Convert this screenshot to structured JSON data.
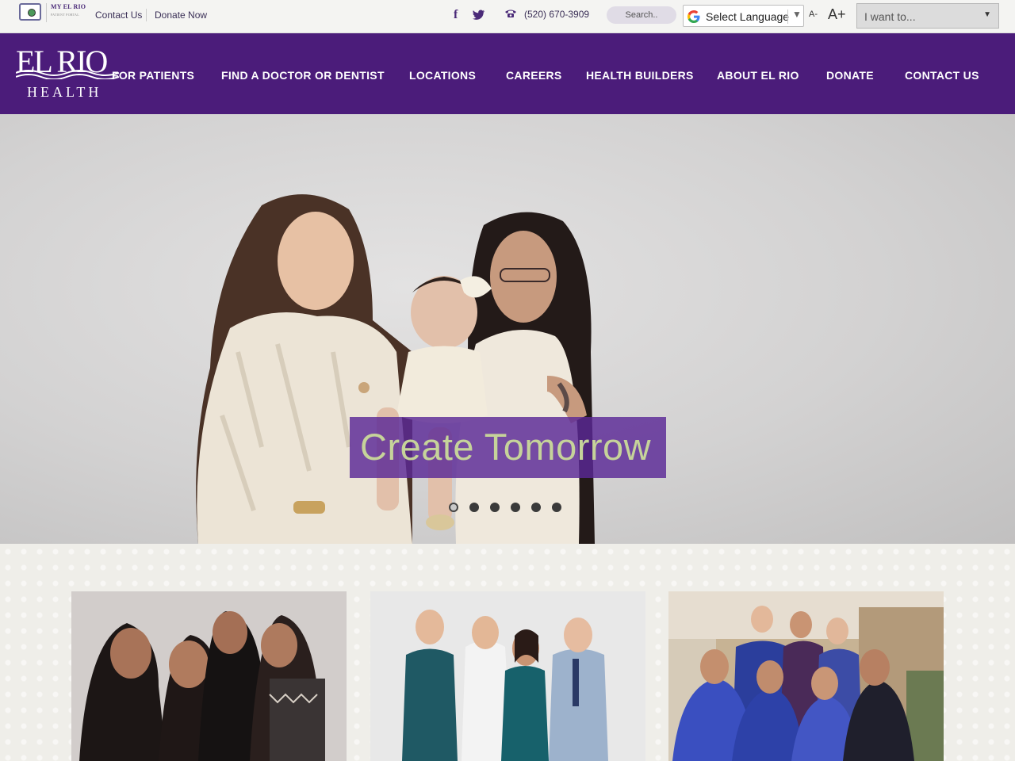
{
  "utility": {
    "portal_logo_line1": "MY EL RIO",
    "portal_logo_line2": "PATIENT PORTAL",
    "contact_label": "Contact Us",
    "donate_label": "Donate Now",
    "phone": "(520) 670-3909",
    "search_placeholder": "Search..",
    "language_label": "Select Language",
    "font_decrease": "A-",
    "font_increase": "A+",
    "iwant_label": "I want to..."
  },
  "icons": [
    "portal-icon",
    "facebook-icon",
    "twitter-icon",
    "phone-icon",
    "google-icon",
    "chevron-down-icon"
  ],
  "logo": {
    "top": "EL RIO",
    "bottom": "HEALTH"
  },
  "nav": {
    "items": [
      {
        "label": "FOR PATIENTS"
      },
      {
        "label": "FIND A DOCTOR OR DENTIST"
      },
      {
        "label": "LOCATIONS"
      },
      {
        "label": "CAREERS"
      },
      {
        "label": "HEALTH BUILDERS"
      },
      {
        "label": "ABOUT EL RIO"
      },
      {
        "label": "DONATE"
      },
      {
        "label": "CONTACT US"
      }
    ]
  },
  "hero": {
    "caption": "Create Tomorrow",
    "slide_count": 6,
    "active_slide": 1
  },
  "colors": {
    "brand_purple": "#4b1c7a",
    "caption_bg": "#5a2896",
    "caption_text": "#c6d39a"
  }
}
